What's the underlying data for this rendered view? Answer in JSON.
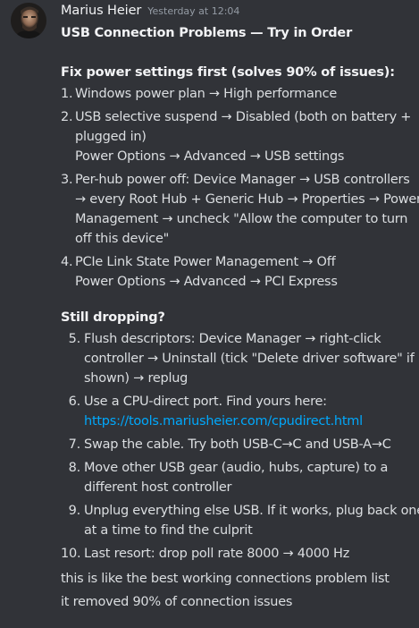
{
  "message": {
    "author": "Marius Heier",
    "timestamp": "Yesterday at 12:04",
    "title": "USB Connection Problems — Try in Order"
  },
  "section1": {
    "heading": "Fix power settings first (solves 90% of issues):",
    "items": [
      {
        "num": "1.",
        "lines": [
          "Windows power plan → High performance"
        ]
      },
      {
        "num": "2.",
        "lines": [
          "USB selective suspend → Disabled (both on battery +",
          "plugged in)",
          "Power Options → Advanced → USB settings"
        ]
      },
      {
        "num": "3.",
        "lines": [
          "Per-hub power off: Device Manager → USB controllers",
          "→ every Root Hub + Generic Hub → Properties → Power",
          "Management → uncheck \"Allow the computer to turn",
          "off this device\""
        ]
      },
      {
        "num": "4.",
        "lines": [
          "PCIe Link State Power Management → Off",
          "Power Options → Advanced → PCI Express"
        ]
      }
    ]
  },
  "section2": {
    "heading": "Still dropping?",
    "items": [
      {
        "num": "5.",
        "lines": [
          "Flush descriptors: Device Manager → right-click",
          "controller → Uninstall (tick \"Delete driver software\" if",
          "shown) → replug"
        ]
      },
      {
        "num": "6.",
        "lines": [
          "Use a CPU-direct port. Find yours here:"
        ],
        "link": "https://tools.mariusheier.com/cpudirect.html"
      },
      {
        "num": "7.",
        "lines": [
          "Swap the cable. Try both USB-C→C and USB-A→C"
        ]
      },
      {
        "num": "8.",
        "lines": [
          "Move other USB gear (audio, hubs, capture) to a",
          "different host controller"
        ]
      },
      {
        "num": "9.",
        "lines": [
          "Unplug everything else USB. If it works, plug back one",
          "at a time to find the culprit"
        ]
      },
      {
        "num": "10.",
        "lines": [
          "Last resort: drop poll rate 8000 → 4000 Hz"
        ]
      }
    ]
  },
  "followups": [
    "this is like the best working connections problem list",
    "it removed 90% of connection issues"
  ],
  "colors": {
    "background": "#313338",
    "text": "#dbdee1",
    "heading": "#f2f3f5",
    "timestamp": "#949ba4",
    "link": "#00a8fc"
  }
}
